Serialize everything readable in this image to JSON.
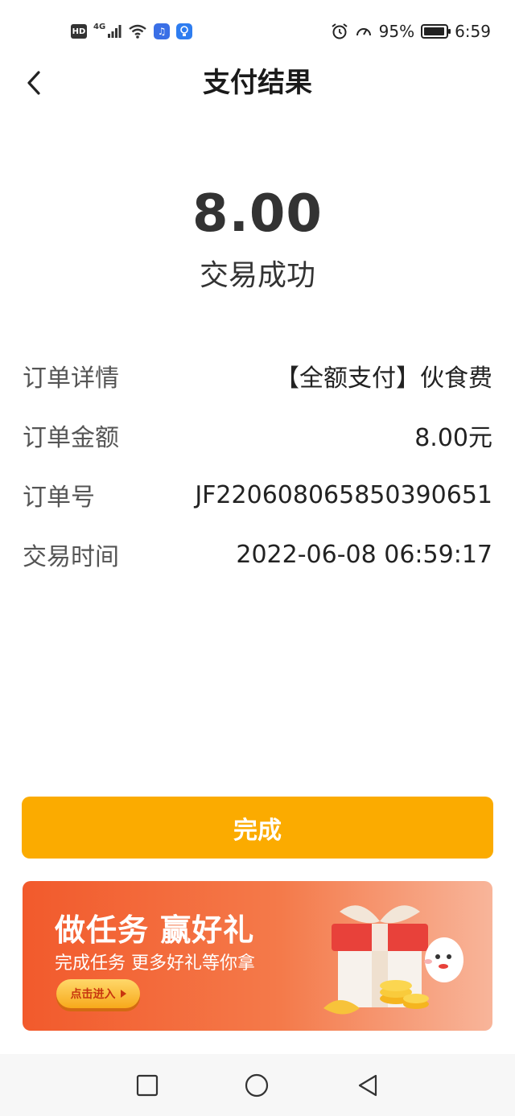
{
  "status_bar": {
    "hd_label": "HD",
    "network_type": "4G",
    "battery_percent": "95%",
    "battery_level": 0.95,
    "time": "6:59",
    "icons": [
      "hd-icon",
      "signal-icon",
      "wifi-icon",
      "music-app-icon",
      "lightbulb-app-icon",
      "alarm-icon",
      "speedometer-icon",
      "battery-icon"
    ]
  },
  "header": {
    "title": "支付结果",
    "back_icon": "chevron-left-icon"
  },
  "payment": {
    "amount": "8.00",
    "status": "交易成功"
  },
  "details": [
    {
      "label": "订单详情",
      "value": "【全额支付】伙食费"
    },
    {
      "label": "订单金额",
      "value": "8.00元"
    },
    {
      "label": "订单号",
      "value": "JF220608065850390651"
    },
    {
      "label": "交易时间",
      "value": "2022-06-08 06:59:17"
    }
  ],
  "actions": {
    "done_label": "完成",
    "done_color": "#fbab00"
  },
  "promo": {
    "title": "做任务 赢好礼",
    "subtitle": "完成任务 更多好礼等你拿",
    "enter_label": "点击进入",
    "colors": {
      "start": "#f25a2c",
      "end": "#f8b59a"
    }
  },
  "nav_bar": {
    "icons": [
      "recent-apps-square-icon",
      "home-circle-icon",
      "back-triangle-icon"
    ]
  }
}
